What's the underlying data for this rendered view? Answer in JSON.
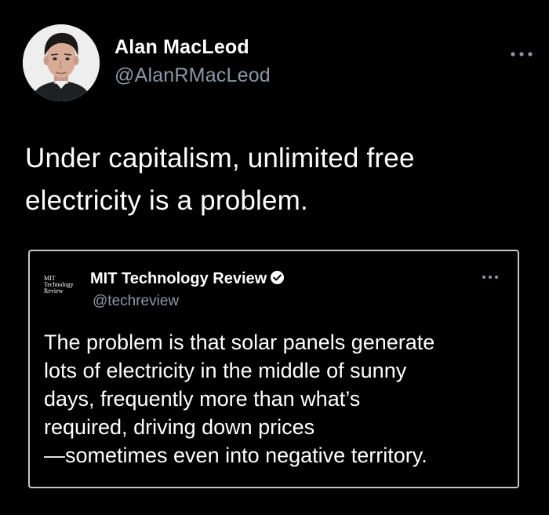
{
  "tweet": {
    "author_name": "Alan MacLeod",
    "author_handle": "@AlanRMacLeod",
    "more_icon": "more-horizontal-icon",
    "text_line1": "Under capitalism, unlimited free",
    "text_line2": "electricity is a problem."
  },
  "quoted_tweet": {
    "logo_line1": "MIT",
    "logo_line2": "Technology",
    "logo_line3": "Review",
    "author_name": "MIT Technology Review",
    "verified_icon": "verified-badge-icon",
    "author_handle": "@techreview",
    "more_icon": "more-horizontal-icon",
    "text_lines": [
      "The problem is that solar panels generate",
      "lots of electricity in the middle of sunny",
      "days, frequently more than what’s",
      "required, driving down prices",
      "—sometimes even into negative territory."
    ]
  },
  "colors": {
    "background": "#000000",
    "text": "#ffffff",
    "secondary_text": "#8b98a5",
    "quote_border": "#c8c8c8"
  }
}
